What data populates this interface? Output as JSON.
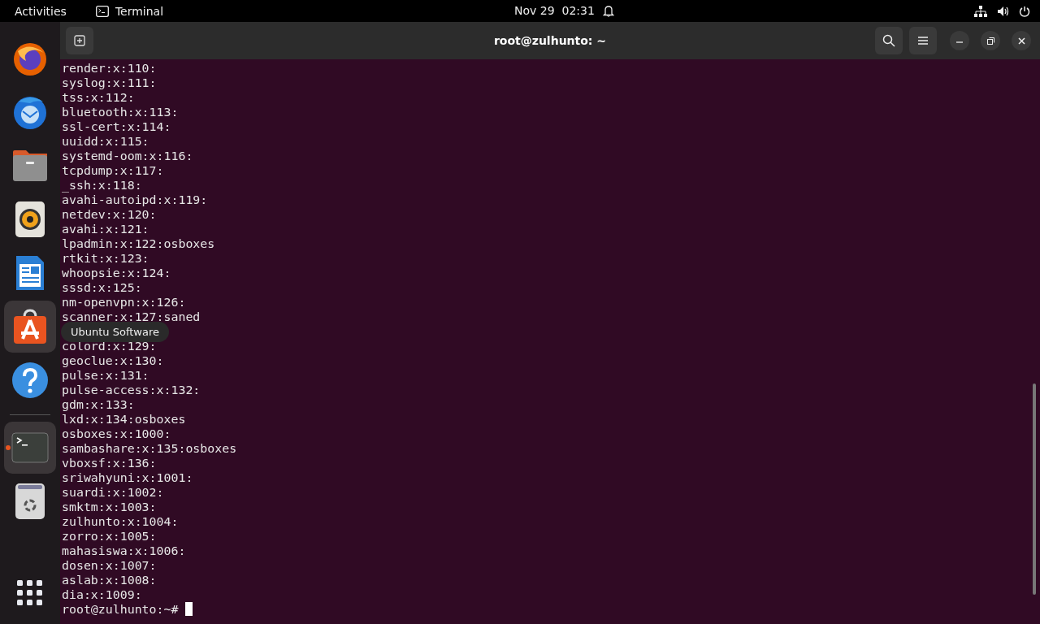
{
  "top_bar": {
    "activities": "Activities",
    "app": "Terminal",
    "clock": "Nov 29  02:31"
  },
  "dock": {
    "items": [
      {
        "kind": "firefox",
        "highlighted": false,
        "running": false
      },
      {
        "kind": "thunderbird",
        "highlighted": false,
        "running": false
      },
      {
        "kind": "files",
        "highlighted": false,
        "running": false
      },
      {
        "kind": "rhythmbox",
        "highlighted": false,
        "running": false
      },
      {
        "kind": "writer",
        "highlighted": false,
        "running": false
      },
      {
        "kind": "software",
        "highlighted": true,
        "running": false
      },
      {
        "kind": "help",
        "highlighted": false,
        "running": false
      },
      {
        "kind": "separator"
      },
      {
        "kind": "terminal",
        "highlighted": true,
        "running": true
      },
      {
        "kind": "trash",
        "highlighted": false,
        "running": false
      }
    ],
    "tooltip": "Ubuntu Software"
  },
  "window": {
    "title": "root@zulhunto: ~"
  },
  "terminal": {
    "lines": [
      "render:x:110:",
      "syslog:x:111:",
      "tss:x:112:",
      "bluetooth:x:113:",
      "ssl-cert:x:114:",
      "uuidd:x:115:",
      "systemd-oom:x:116:",
      "tcpdump:x:117:",
      "_ssh:x:118:",
      "avahi-autoipd:x:119:",
      "netdev:x:120:",
      "avahi:x:121:",
      "lpadmin:x:122:osboxes",
      "rtkit:x:123:",
      "whoopsie:x:124:",
      "sssd:x:125:",
      "nm-openvpn:x:126:",
      "scanner:x:127:saned"
    ],
    "lines_below_tooltip": [
      "colord:x:129:",
      "geoclue:x:130:",
      "pulse:x:131:",
      "pulse-access:x:132:",
      "gdm:x:133:",
      "lxd:x:134:osboxes",
      "osboxes:x:1000:",
      "sambashare:x:135:osboxes",
      "vboxsf:x:136:",
      "sriwahyuni:x:1001:",
      "suardi:x:1002:",
      "smktm:x:1003:",
      "zulhunto:x:1004:",
      "zorro:x:1005:",
      "mahasiswa:x:1006:",
      "dosen:x:1007:",
      "aslab:x:1008:",
      "dia:x:1009:"
    ],
    "prompt": "root@zulhunto:~#"
  }
}
